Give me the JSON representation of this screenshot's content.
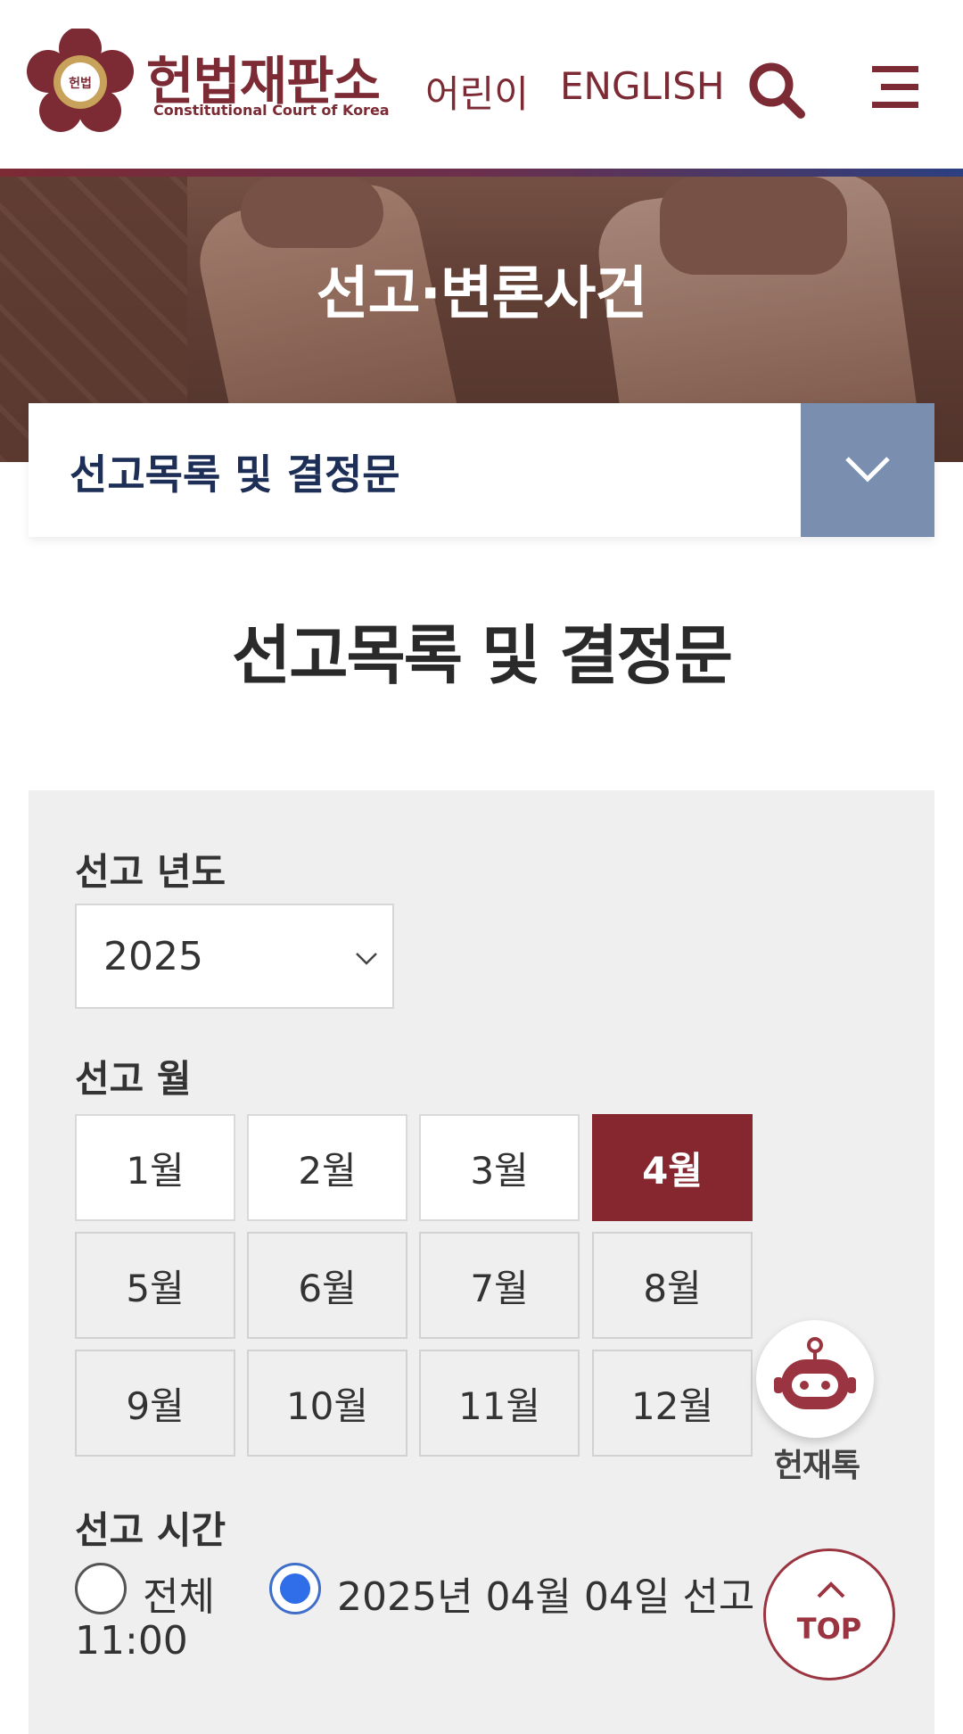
{
  "header": {
    "logo_ko": "헌법재판소",
    "logo_en": "Constitutional Court of Korea",
    "emblem_text": "헌법",
    "nav_kids": "어린이",
    "nav_english": "ENGLISH",
    "search_icon": "search-icon",
    "menu_icon": "hamburger-menu-icon",
    "brand_color": "#7c2a34"
  },
  "banner": {
    "title": "선고·변론사건"
  },
  "subnav": {
    "selected": "선고목록 및 결정문",
    "toggle_icon": "chevron-down-icon"
  },
  "page": {
    "title": "선고목록 및 결정문"
  },
  "filter": {
    "year_label": "선고 년도",
    "year_value": "2025",
    "month_label": "선고 월",
    "months": [
      "1월",
      "2월",
      "3월",
      "4월",
      "5월",
      "6월",
      "7월",
      "8월",
      "9월",
      "10월",
      "11월",
      "12월"
    ],
    "active_month": "4월",
    "time_label": "선고 시간",
    "time_options": [
      {
        "label": "전체",
        "checked": false
      },
      {
        "label": "2025년 04월 04일 선고",
        "checked": true
      }
    ],
    "time_option_wrap": "11:00",
    "active_color": "#86262f"
  },
  "floating": {
    "chatbot_label": "헌재톡",
    "top_label": "TOP"
  }
}
